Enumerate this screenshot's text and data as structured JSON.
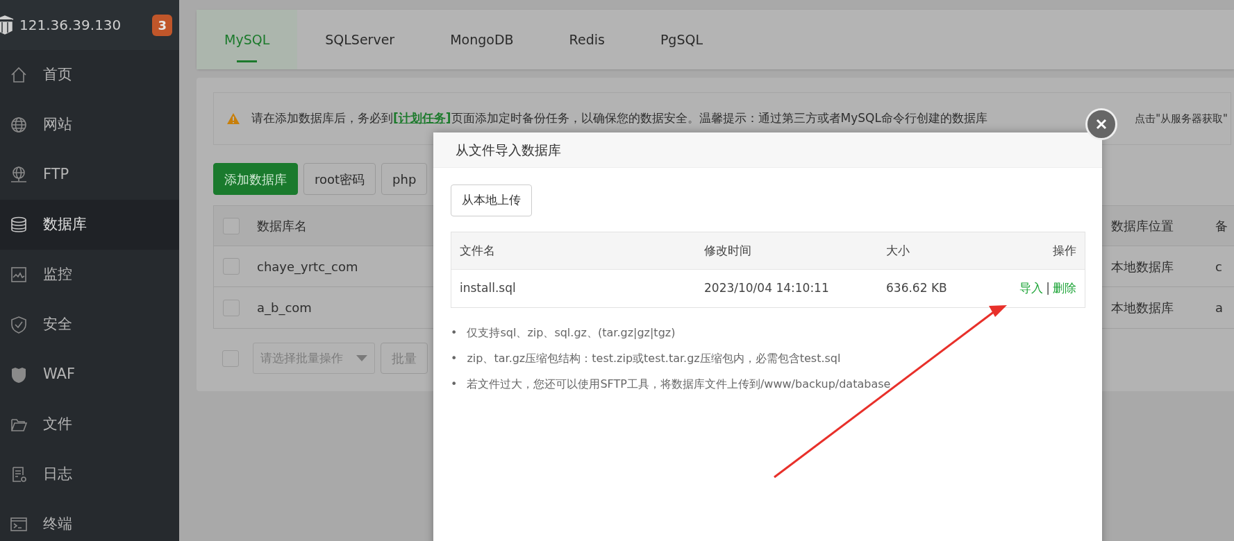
{
  "sidebar": {
    "server": "121.36.39.130",
    "badge": "3",
    "items": [
      {
        "label": "首页",
        "selected": false
      },
      {
        "label": "网站",
        "selected": false
      },
      {
        "label": "FTP",
        "selected": false
      },
      {
        "label": "数据库",
        "selected": true
      },
      {
        "label": "监控",
        "selected": false
      },
      {
        "label": "安全",
        "selected": false
      },
      {
        "label": "WAF",
        "selected": false
      },
      {
        "label": "文件",
        "selected": false
      },
      {
        "label": "日志",
        "selected": false
      },
      {
        "label": "终端",
        "selected": false
      }
    ]
  },
  "tabs": [
    {
      "label": "MySQL",
      "selected": true
    },
    {
      "label": "SQLServer",
      "selected": false
    },
    {
      "label": "MongoDB",
      "selected": false
    },
    {
      "label": "Redis",
      "selected": false
    },
    {
      "label": "PgSQL",
      "selected": false
    }
  ],
  "alert": {
    "before": "请在添加数据库后，务必到",
    "link": "[计划任务]",
    "after": "页面添加定时备份任务，以确保您的数据安全。温馨提示：通过第三方或者MySQL命令行创建的数据库",
    "tail": "点击\"从服务器获取\""
  },
  "toolbar": [
    {
      "label": "添加数据库",
      "kind": "primary"
    },
    {
      "label": "root密码",
      "kind": "default"
    },
    {
      "label": "php",
      "kind": "default"
    }
  ],
  "table": {
    "all_checked": false,
    "columns": [
      "数据库名",
      "数据库位置",
      "备"
    ],
    "rows": [
      {
        "checked": false,
        "cells": [
          "chaye_yrtc_com",
          "本地数据库",
          "c"
        ]
      },
      {
        "checked": false,
        "cells": [
          "a_b_com",
          "本地数据库",
          "a"
        ]
      }
    ]
  },
  "batch": {
    "checked": false,
    "placeholder": "请选择批量操作",
    "button": "批量"
  },
  "modal": {
    "title": "从文件导入数据库",
    "upload_button": "从本地上传",
    "columns": [
      "文件名",
      "修改时间",
      "大小",
      "操作"
    ],
    "files": [
      {
        "name": "install.sql",
        "modified": "2023/10/04 14:10:11",
        "size": "636.62 KB",
        "actions": [
          "导入",
          "删除"
        ],
        "separator": "|"
      }
    ],
    "bullet": "•",
    "notes": [
      "仅支持sql、zip、sql.gz、(tar.gz|gz|tgz)",
      "zip、tar.gz压缩包结构：test.zip或test.tar.gz压缩包内，必需包含test.sql",
      "若文件过大，您还可以使用SFTP工具，将数据库文件上传到/www/backup/database"
    ]
  }
}
